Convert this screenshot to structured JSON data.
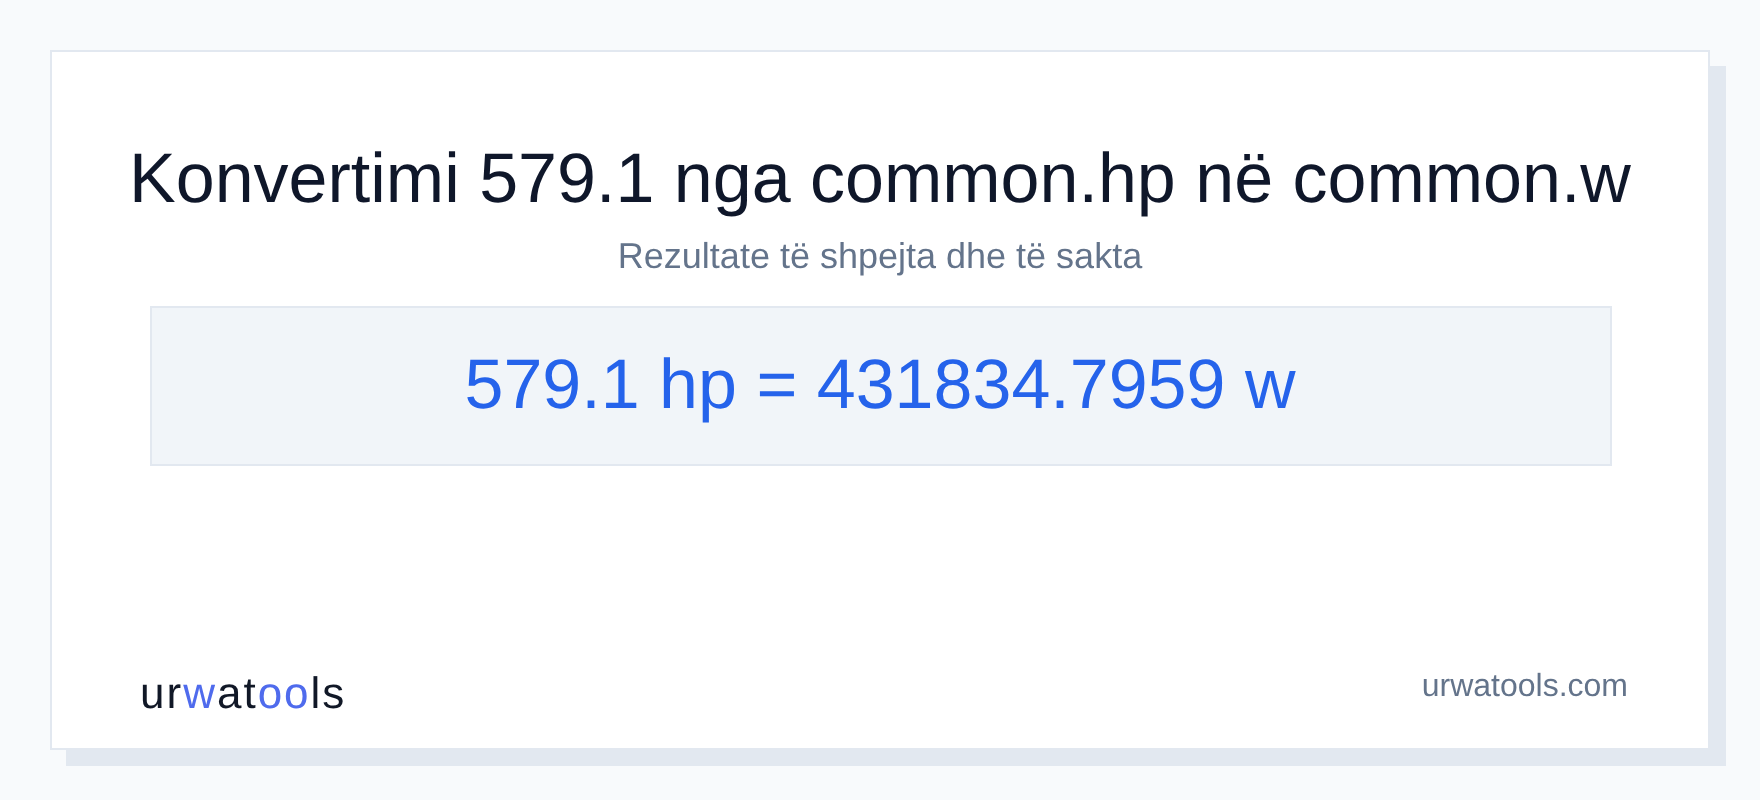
{
  "title": "Konvertimi 579.1 nga common.hp në common.w",
  "subtitle": "Rezultate të shpejta dhe të sakta",
  "result": "579.1 hp = 431834.7959 w",
  "logo": [
    {
      "text": "ur",
      "accent": false
    },
    {
      "text": "w",
      "accent": true
    },
    {
      "text": "at",
      "accent": false
    },
    {
      "text": "oo",
      "accent": true
    },
    {
      "text": "ls",
      "accent": false
    }
  ],
  "site": "urwatools.com"
}
